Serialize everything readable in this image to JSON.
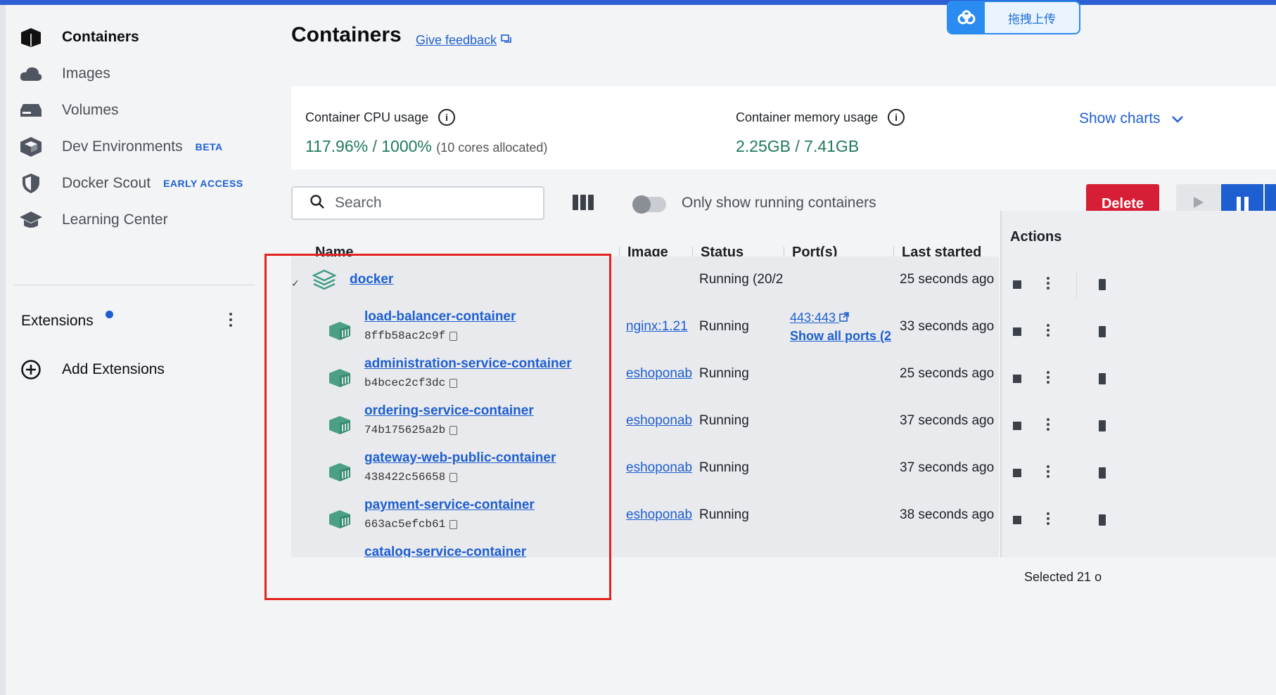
{
  "sidebar": {
    "items": [
      {
        "label": "Containers",
        "icon": "containers-icon",
        "badge": ""
      },
      {
        "label": "Images",
        "icon": "cloud-icon",
        "badge": ""
      },
      {
        "label": "Volumes",
        "icon": "volume-drive-icon",
        "badge": ""
      },
      {
        "label": "Dev Environments",
        "icon": "dev-env-cube-icon",
        "badge": "BETA"
      },
      {
        "label": "Docker Scout",
        "icon": "shield-icon",
        "badge": "EARLY ACCESS"
      },
      {
        "label": "Learning Center",
        "icon": "graduation-cap-icon",
        "badge": ""
      }
    ],
    "extensions_label": "Extensions",
    "add_extensions_label": "Add Extensions"
  },
  "header": {
    "title": "Containers",
    "feedback_label": "Give feedback"
  },
  "upload_widget": {
    "label": "拖拽上传"
  },
  "stats": {
    "cpu_label": "Container CPU usage",
    "cpu_value": "117.96%",
    "cpu_slash": " / ",
    "cpu_total": "1000%",
    "cpu_sub": "(10 cores allocated)",
    "mem_label": "Container memory usage",
    "mem_value": "2.25GB",
    "mem_slash": " / ",
    "mem_total": "7.41GB",
    "show_charts_label": "Show charts"
  },
  "toolbar": {
    "search_placeholder": "Search",
    "toggle_label": "Only show running containers",
    "delete_label": "Delete"
  },
  "table": {
    "columns": {
      "name": "Name",
      "image": "Image",
      "status": "Status",
      "ports": "Port(s)",
      "last_started": "Last started",
      "actions": "Actions"
    },
    "group": {
      "name": "docker",
      "status": "Running (20/2",
      "last_started": "25 seconds ago"
    },
    "rows": [
      {
        "name": "load-balancer-container",
        "id": "8ffb58ac2c9f",
        "image": "nginx:1.21",
        "status": "Running",
        "port": "443:443",
        "ports_all": "Show all ports (2",
        "last_started": "33 seconds ago"
      },
      {
        "name": "administration-service-container",
        "id": "b4bcec2cf3dc",
        "image": "eshoponab",
        "status": "Running",
        "port": "",
        "ports_all": "",
        "last_started": "25 seconds ago"
      },
      {
        "name": "ordering-service-container",
        "id": "74b175625a2b",
        "image": "eshoponab",
        "status": "Running",
        "port": "",
        "ports_all": "",
        "last_started": "37 seconds ago"
      },
      {
        "name": "gateway-web-public-container",
        "id": "438422c56658",
        "image": "eshoponab",
        "status": "Running",
        "port": "",
        "ports_all": "",
        "last_started": "37 seconds ago"
      },
      {
        "name": "payment-service-container",
        "id": "663ac5efcb61",
        "image": "eshoponab",
        "status": "Running",
        "port": "",
        "ports_all": "",
        "last_started": "38 seconds ago"
      },
      {
        "name": "catalog-service-container",
        "id": "",
        "image": "",
        "status": "",
        "port": "",
        "ports_all": "",
        "last_started": ""
      }
    ],
    "footer_selected": "Selected 21 o"
  },
  "colors": {
    "accent": "#1d5fd1",
    "delete": "#d61f37",
    "stat_value": "#1e7a5a",
    "highlight_box": "#e3231f"
  }
}
